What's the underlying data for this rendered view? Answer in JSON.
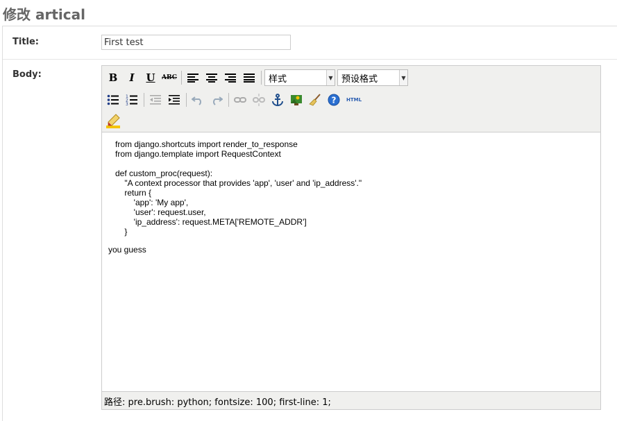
{
  "page": {
    "title": "修改 artical"
  },
  "form": {
    "title_label": "Title:",
    "title_value": "First test",
    "body_label": "Body:"
  },
  "editor": {
    "toolbar": {
      "bold": "B",
      "italic": "I",
      "underline": "U",
      "strikethrough": "ABC",
      "style_select": "样式",
      "format_select": "预设格式",
      "html_button": "HTML"
    },
    "content": {
      "code_lines": [
        "from django.shortcuts import render_to_response",
        "from django.template import RequestContext",
        "",
        "def custom_proc(request):",
        "    \"A context processor that provides 'app', 'user' and 'ip_address'.\"",
        "    return {",
        "        'app': 'My app',",
        "        'user': request.user,",
        "        'ip_address': request.META['REMOTE_ADDR']",
        "    }"
      ],
      "paragraph": "you guess"
    },
    "status_path": "路径: pre.brush: python; fontsize: 100; first-line: 1;"
  }
}
